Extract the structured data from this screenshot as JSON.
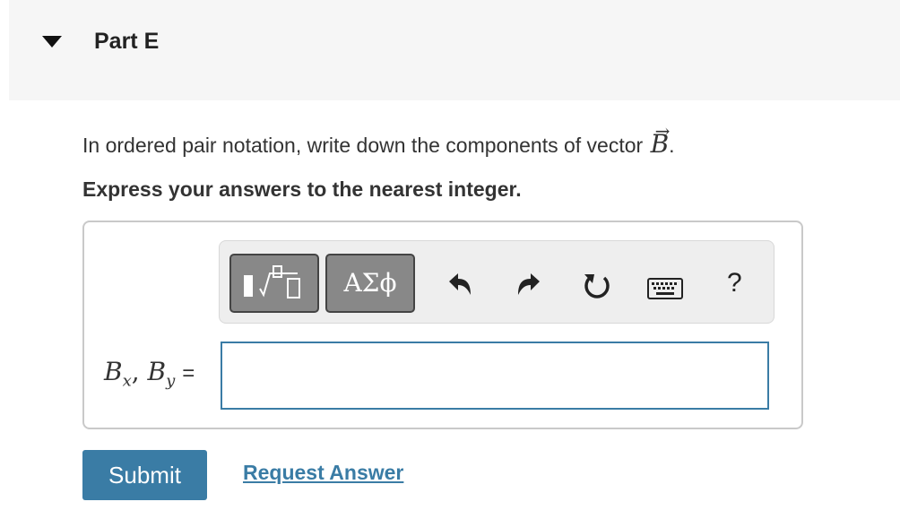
{
  "part": {
    "title": "Part E"
  },
  "question": {
    "prompt_text": "In ordered pair notation, write down the components of vector ",
    "vector_symbol": "B",
    "prompt_end": ".",
    "instruction": "Express your answers to the nearest integer."
  },
  "toolbar": {
    "symbols_label": "ΑΣϕ",
    "help_label": "?",
    "icons": [
      "templates-icon",
      "undo-icon",
      "redo-icon",
      "reset-icon",
      "keyboard-icon",
      "help-icon"
    ]
  },
  "answer": {
    "label_1": "B",
    "sub_1": "x",
    "label_2": "B",
    "sub_2": "y",
    "equals": "=",
    "value": ""
  },
  "actions": {
    "submit_label": "Submit",
    "request_label": "Request Answer"
  },
  "colors": {
    "accent": "#3a7ca5",
    "header_bg": "#f6f6f6",
    "toolbar_btn": "#888888"
  }
}
